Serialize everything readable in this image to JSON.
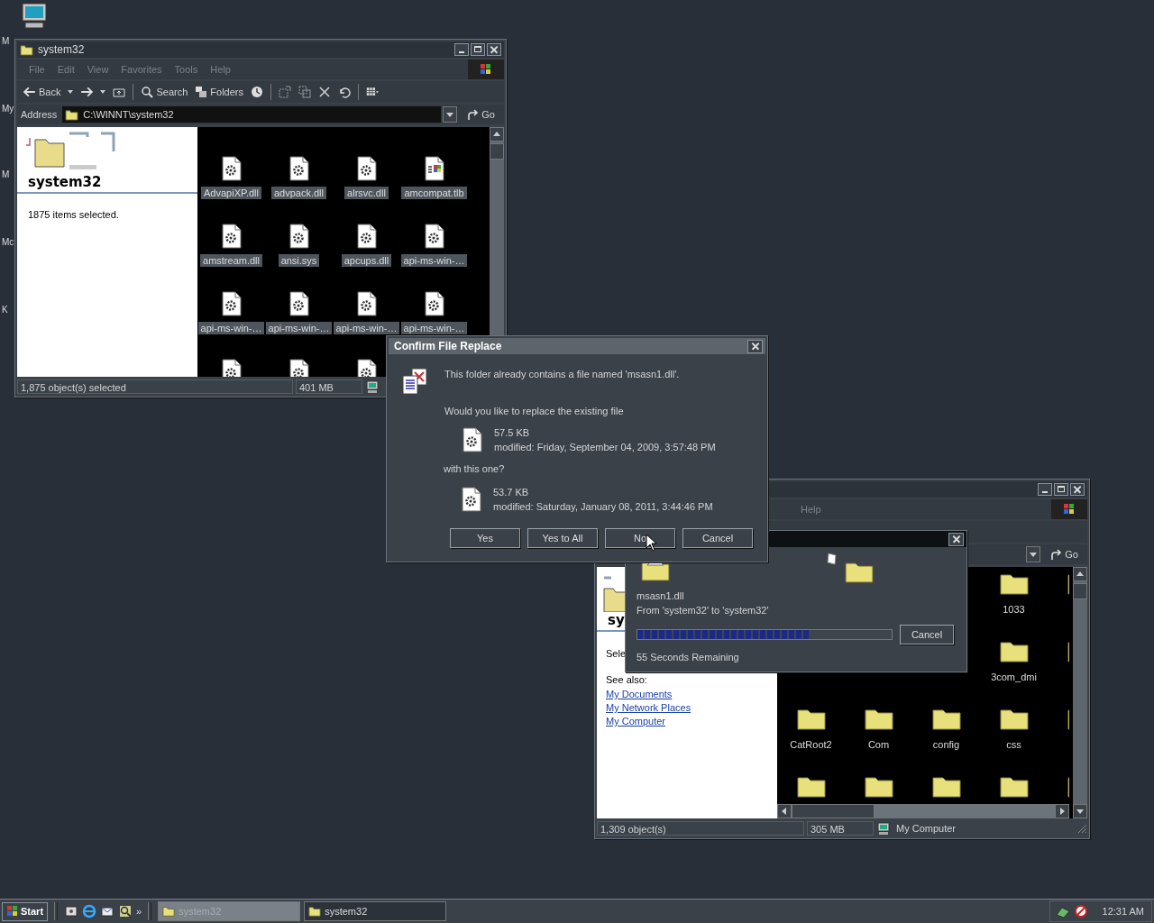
{
  "desktop": {
    "icon_labels": [
      "M",
      "My",
      "M",
      "Mc",
      "K"
    ]
  },
  "explorer_window": {
    "title": "system32",
    "menu": [
      {
        "label": "File",
        "disabled": true
      },
      {
        "label": "Edit",
        "disabled": true
      },
      {
        "label": "View",
        "disabled": true
      },
      {
        "label": "Favorites",
        "disabled": true
      },
      {
        "label": "Tools",
        "disabled": true
      },
      {
        "label": "Help",
        "disabled": true
      }
    ],
    "toolbar": {
      "back": "Back",
      "search": "Search",
      "folders": "Folders"
    },
    "address": {
      "label": "Address",
      "value": "C:\\WINNT\\system32",
      "go": "Go"
    },
    "pane": {
      "heading": "system32",
      "info": "1875 items selected."
    },
    "items": [
      {
        "label": "AdvapiXP.dll",
        "kind": "file",
        "selected": true
      },
      {
        "label": "advpack.dll",
        "kind": "file",
        "selected": true
      },
      {
        "label": "alrsvc.dll",
        "kind": "file",
        "selected": true
      },
      {
        "label": "amcompat.tlb",
        "kind": "library",
        "selected": true
      },
      {
        "label": "amstream.dll",
        "kind": "file",
        "selected": true
      },
      {
        "label": "ansi.sys",
        "kind": "file",
        "selected": true
      },
      {
        "label": "apcups.dll",
        "kind": "file",
        "selected": true
      },
      {
        "label": "api-ms-win-…",
        "kind": "file",
        "selected": true
      },
      {
        "label": "api-ms-win-…",
        "kind": "file",
        "selected": true
      },
      {
        "label": "api-ms-win-…",
        "kind": "file",
        "selected": true
      },
      {
        "label": "api-ms-win-…",
        "kind": "file",
        "selected": true
      },
      {
        "label": "api-ms-win-…",
        "kind": "file",
        "selected": true
      }
    ],
    "icons_below": [
      {
        "kind": "file"
      },
      {
        "kind": "file"
      },
      {
        "kind": "file"
      }
    ],
    "status": [
      "1,875 object(s) selected",
      "401 MB"
    ]
  },
  "second_window": {
    "menu": [
      {
        "label": "Help",
        "disabled": true
      }
    ],
    "address": {
      "go": "Go"
    },
    "pane": {
      "heading": "sy",
      "line": "Sele",
      "see_also": "See also:",
      "links": [
        "My Documents",
        "My Network Places",
        "My Computer"
      ]
    },
    "items": [
      {
        "kind": "folder"
      },
      {
        "kind": "folder"
      },
      {
        "kind": "folder"
      },
      {
        "kind": "folder",
        "label": "1033"
      },
      {
        "kind": "folder"
      },
      {
        "kind": "folder"
      },
      {
        "kind": "folder"
      },
      {
        "kind": "folder"
      },
      {
        "kind": "folder",
        "label": "3com_dmi"
      },
      {
        "kind": "folder"
      },
      {
        "kind": "folder",
        "label": "CatRoot2"
      },
      {
        "kind": "folder",
        "label": "Com"
      },
      {
        "kind": "folder",
        "label": "config"
      },
      {
        "kind": "folder",
        "label": "css"
      },
      {
        "kind": "folder"
      },
      {
        "kind": "folder"
      },
      {
        "kind": "folder"
      },
      {
        "kind": "folder"
      },
      {
        "kind": "folder"
      },
      {
        "kind": "folder"
      }
    ],
    "status": [
      "1,309 object(s)",
      "305 MB",
      "My Computer"
    ]
  },
  "confirm_dialog": {
    "title": "Confirm File Replace",
    "message": "This folder already contains a file named 'msasn1.dll'.",
    "question": "Would you like to replace the existing file",
    "existing": {
      "size": "57.5 KB",
      "modified": "modified: Friday, September 04, 2009, 3:57:48 PM"
    },
    "with": "with this one?",
    "replacement": {
      "size": "53.7 KB",
      "modified": "modified: Saturday, January 08, 2011, 3:44:46 PM"
    },
    "buttons": [
      "Yes",
      "Yes to All",
      "No",
      "Cancel"
    ]
  },
  "copy_dialog": {
    "file": "msasn1.dll",
    "route": "From 'system32' to 'system32'",
    "level": 0.68,
    "remaining": "55 Seconds Remaining",
    "cancel": "Cancel"
  },
  "taskbar": {
    "start": "Start",
    "more": "»",
    "tasks": [
      {
        "label": "system32",
        "selected": true
      },
      {
        "label": "system32",
        "selected": false
      }
    ],
    "clock": "12:31 AM"
  }
}
